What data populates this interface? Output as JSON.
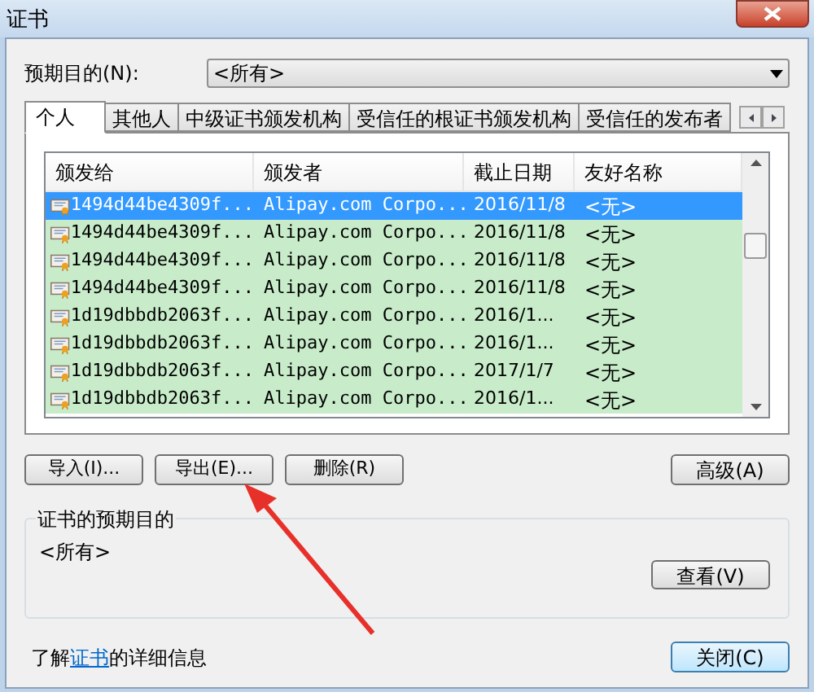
{
  "window": {
    "title": "证书"
  },
  "purpose": {
    "label": "预期目的(N):",
    "value": "<所有>"
  },
  "tabs": [
    {
      "label": "个人",
      "selected": true
    },
    {
      "label": "其他人",
      "selected": false
    },
    {
      "label": "中级证书颁发机构",
      "selected": false
    },
    {
      "label": "受信任的根证书颁发机构",
      "selected": false
    },
    {
      "label": "受信任的发布者",
      "selected": false
    }
  ],
  "table": {
    "columns": [
      "颁发给",
      "颁发者",
      "截止日期",
      "友好名称"
    ],
    "rows": [
      {
        "issued_to": "1494d44be4309f...",
        "issued_by": "Alipay.com Corpo...",
        "expiry": "2016/11/8",
        "friendly_name": "<无>",
        "selected": true
      },
      {
        "issued_to": "1494d44be4309f...",
        "issued_by": "Alipay.com Corpo...",
        "expiry": "2016/11/8",
        "friendly_name": "<无>",
        "selected": false
      },
      {
        "issued_to": "1494d44be4309f...",
        "issued_by": "Alipay.com Corpo...",
        "expiry": "2016/11/8",
        "friendly_name": "<无>",
        "selected": false
      },
      {
        "issued_to": "1494d44be4309f...",
        "issued_by": "Alipay.com Corpo...",
        "expiry": "2016/11/8",
        "friendly_name": "<无>",
        "selected": false
      },
      {
        "issued_to": "1d19dbbdb2063f...",
        "issued_by": "Alipay.com Corpo...",
        "expiry": "2016/1...",
        "friendly_name": "<无>",
        "selected": false
      },
      {
        "issued_to": "1d19dbbdb2063f...",
        "issued_by": "Alipay.com Corpo...",
        "expiry": "2016/1...",
        "friendly_name": "<无>",
        "selected": false
      },
      {
        "issued_to": "1d19dbbdb2063f...",
        "issued_by": "Alipay.com Corpo...",
        "expiry": "2017/1/7",
        "friendly_name": "<无>",
        "selected": false
      },
      {
        "issued_to": "1d19dbbdb2063f...",
        "issued_by": "Alipay.com Corpo...",
        "expiry": "2016/1...",
        "friendly_name": "<无>",
        "selected": false
      }
    ]
  },
  "actions": [
    "导入(I)...",
    "导出(E)...",
    "删除(R)"
  ],
  "advanced_button": "高级(A)",
  "purpose_group": {
    "title": "证书的预期目的",
    "value": "<所有>",
    "view_button": "查看(V)"
  },
  "footer": {
    "text_before": "了解",
    "link": "证书",
    "text_after": "的详细信息",
    "close_button": "关闭(C)"
  }
}
